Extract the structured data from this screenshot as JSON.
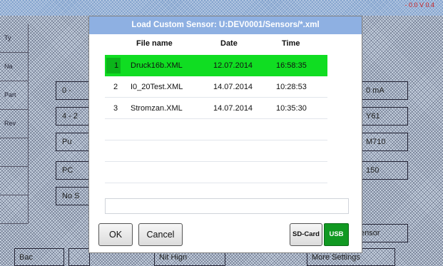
{
  "background": {
    "status_readout": "- 0.0 V\n0.4",
    "side_labels": [
      "Ty",
      "Na",
      "Part",
      "Rev",
      "",
      "",
      ""
    ],
    "left_boxes": [
      "0 -",
      "4 - 2",
      "Pu",
      "PC",
      "No S"
    ],
    "right_boxes": [
      "0 mA",
      "Y61",
      "M710",
      "150",
      "",
      "ensor"
    ],
    "bottom_items": [
      "Bac",
      "",
      "",
      "Nit Hign",
      "",
      "More Settings"
    ]
  },
  "dialog": {
    "title": "Load Custom Sensor:  U:DEV0001/Sensors/*.xml",
    "columns": {
      "name": "File name",
      "date": "Date",
      "time": "Time"
    },
    "rows": [
      {
        "index": "1",
        "name": "Druck16b.XML",
        "date": "12.07.2014",
        "time": "16:58:35",
        "selected": true
      },
      {
        "index": "2",
        "name": "I0_20Test.XML",
        "date": "14.07.2014",
        "time": "10:28:53",
        "selected": false
      },
      {
        "index": "3",
        "name": "Stromzan.XML",
        "date": "14.07.2014",
        "time": "10:35:30",
        "selected": false
      },
      {
        "index": "",
        "name": "",
        "date": "",
        "time": "",
        "selected": false
      },
      {
        "index": "",
        "name": "",
        "date": "",
        "time": "",
        "selected": false
      },
      {
        "index": "",
        "name": "",
        "date": "",
        "time": "",
        "selected": false
      }
    ],
    "filename_value": "",
    "buttons": {
      "ok": "OK",
      "cancel": "Cancel",
      "sd_card": "SD-Card",
      "usb": "USB"
    },
    "colors": {
      "title_bar": "#8eb0e2",
      "selected_row": "#10dd22",
      "usb_active": "#119922"
    }
  }
}
